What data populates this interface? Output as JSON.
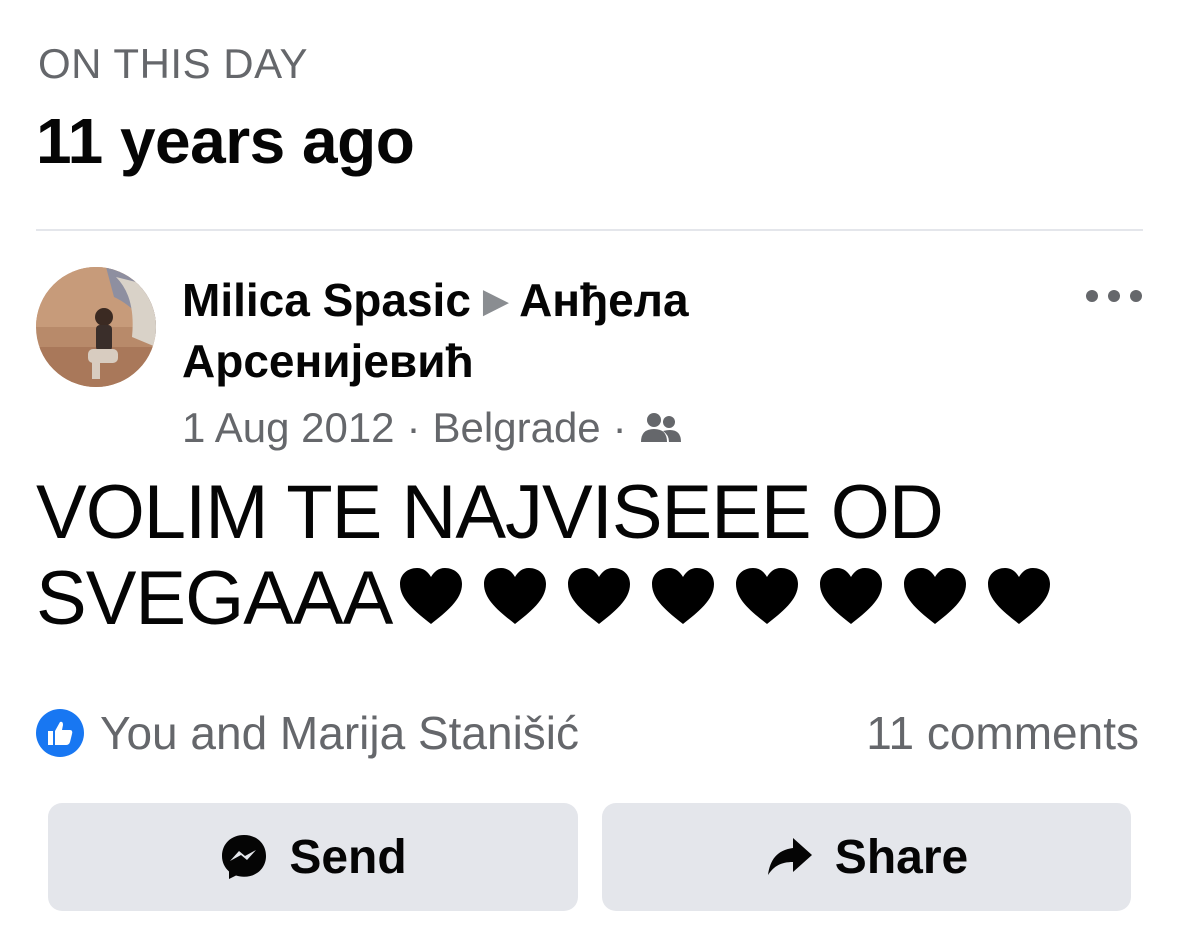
{
  "header": {
    "label": "ON THIS DAY",
    "title": "11 years ago"
  },
  "post": {
    "author": "Milica Spasic",
    "target": "Анђела Арсенијевић",
    "date": "1 Aug 2012",
    "location": "Belgrade",
    "separator": "·",
    "audience_icon": "friends-icon",
    "text": "VOLIM TE NAJVISEEE OD SVEGAAA",
    "heart_count": 8,
    "heart_color": "#000000"
  },
  "reactions": {
    "icon": "like-icon",
    "icon_color": "#1877f2",
    "summary": "You and Marija Stanišić",
    "comments": "11 comments"
  },
  "actions": {
    "send_label": "Send",
    "share_label": "Share"
  },
  "colors": {
    "secondary_text": "#65676b",
    "button_bg": "#e4e6eb",
    "divider": "#e4e6eb"
  }
}
